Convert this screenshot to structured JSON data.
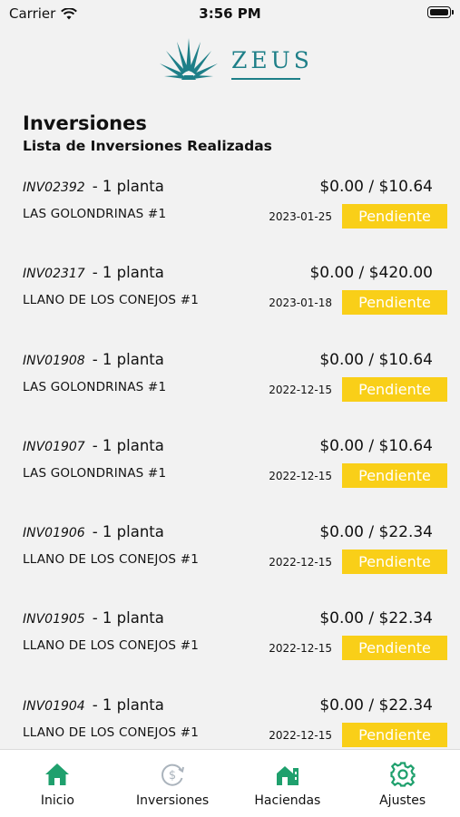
{
  "status_bar": {
    "carrier": "Carrier",
    "time": "3:56 PM"
  },
  "logo": {
    "text": "ZEUS"
  },
  "header": {
    "title": "Inversiones",
    "subtitle": "Lista de Inversiones Realizadas"
  },
  "investments": [
    {
      "code": "INV02392",
      "quantity": "- 1 planta",
      "amount": "$0.00 / $10.64",
      "farm": "LAS GOLONDRINAS #1",
      "date": "2023-01-25",
      "status": "Pendiente"
    },
    {
      "code": "INV02317",
      "quantity": "- 1 planta",
      "amount": "$0.00 / $420.00",
      "farm": "LLANO DE LOS CONEJOS #1",
      "date": "2023-01-18",
      "status": "Pendiente"
    },
    {
      "code": "INV01908",
      "quantity": "- 1 planta",
      "amount": "$0.00 / $10.64",
      "farm": "LAS GOLONDRINAS #1",
      "date": "2022-12-15",
      "status": "Pendiente"
    },
    {
      "code": "INV01907",
      "quantity": "- 1 planta",
      "amount": "$0.00 / $10.64",
      "farm": "LAS GOLONDRINAS #1",
      "date": "2022-12-15",
      "status": "Pendiente"
    },
    {
      "code": "INV01906",
      "quantity": "- 1 planta",
      "amount": "$0.00 / $22.34",
      "farm": "LLANO DE LOS CONEJOS #1",
      "date": "2022-12-15",
      "status": "Pendiente"
    },
    {
      "code": "INV01905",
      "quantity": "- 1 planta",
      "amount": "$0.00 / $22.34",
      "farm": "LLANO DE LOS CONEJOS #1",
      "date": "2022-12-15",
      "status": "Pendiente"
    },
    {
      "code": "INV01904",
      "quantity": "- 1 planta",
      "amount": "$0.00 / $22.34",
      "farm": "LLANO DE LOS CONEJOS #1",
      "date": "2022-12-15",
      "status": "Pendiente"
    }
  ],
  "colors": {
    "accent_green": "#1fa06d",
    "status_yellow": "#f9cf18",
    "logo_teal": "#1e7f88",
    "inactive_icon": "#aab3bc"
  },
  "tabs": [
    {
      "label": "Inicio",
      "icon": "home-icon"
    },
    {
      "label": "Inversiones",
      "icon": "dollar-cycle-icon"
    },
    {
      "label": "Haciendas",
      "icon": "farm-icon"
    },
    {
      "label": "Ajustes",
      "icon": "gear-icon"
    }
  ]
}
